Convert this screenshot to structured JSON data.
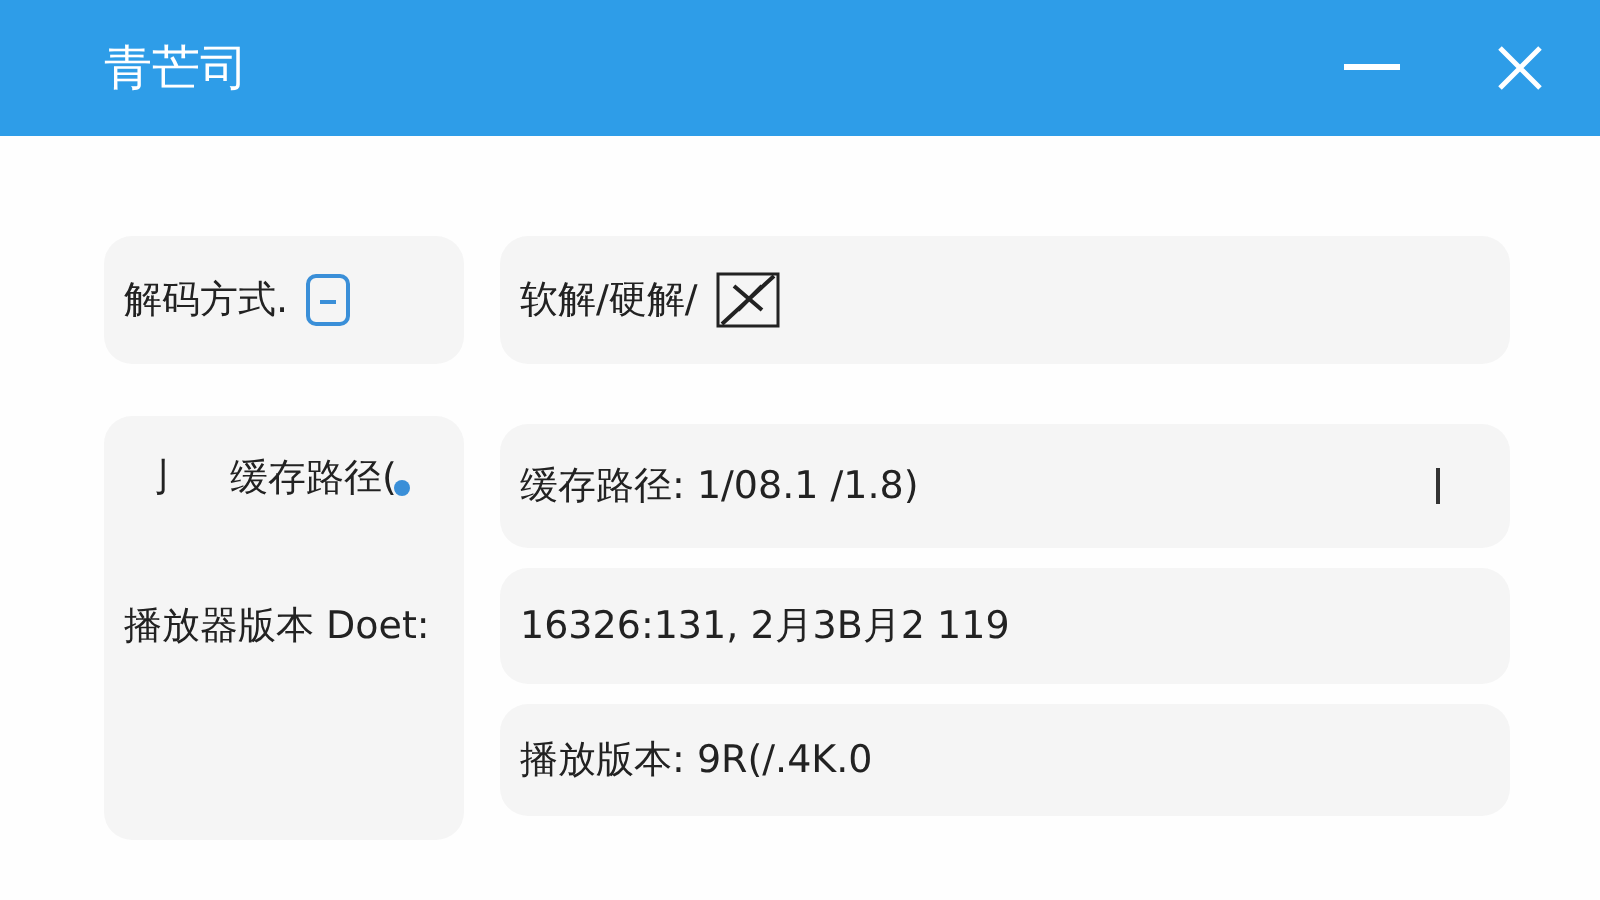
{
  "window": {
    "title": "青芒司"
  },
  "decode": {
    "label": "解码方式.",
    "value": "软解/硬解/"
  },
  "cache": {
    "mark": "亅",
    "label": "缓存路径(",
    "value": "缓存路径: 1/08.1 /1.8)"
  },
  "player_version": {
    "label": "播放器版本 Doet:",
    "value": "16326:131, 2月3B月2 119"
  },
  "play_version": {
    "value": "播放版本: 9R(/.4K.0"
  }
}
